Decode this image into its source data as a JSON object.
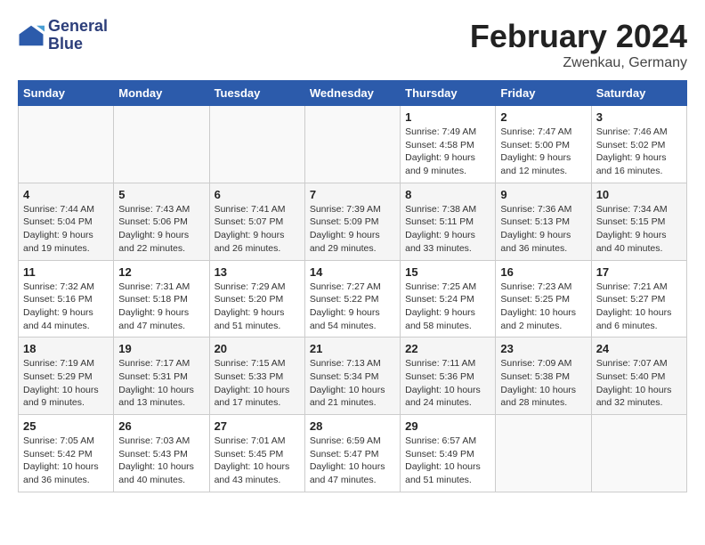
{
  "logo": {
    "line1": "General",
    "line2": "Blue"
  },
  "title": "February 2024",
  "subtitle": "Zwenkau, Germany",
  "days_of_week": [
    "Sunday",
    "Monday",
    "Tuesday",
    "Wednesday",
    "Thursday",
    "Friday",
    "Saturday"
  ],
  "weeks": [
    [
      {
        "day": "",
        "info": ""
      },
      {
        "day": "",
        "info": ""
      },
      {
        "day": "",
        "info": ""
      },
      {
        "day": "",
        "info": ""
      },
      {
        "day": "1",
        "info": "Sunrise: 7:49 AM\nSunset: 4:58 PM\nDaylight: 9 hours\nand 9 minutes."
      },
      {
        "day": "2",
        "info": "Sunrise: 7:47 AM\nSunset: 5:00 PM\nDaylight: 9 hours\nand 12 minutes."
      },
      {
        "day": "3",
        "info": "Sunrise: 7:46 AM\nSunset: 5:02 PM\nDaylight: 9 hours\nand 16 minutes."
      }
    ],
    [
      {
        "day": "4",
        "info": "Sunrise: 7:44 AM\nSunset: 5:04 PM\nDaylight: 9 hours\nand 19 minutes."
      },
      {
        "day": "5",
        "info": "Sunrise: 7:43 AM\nSunset: 5:06 PM\nDaylight: 9 hours\nand 22 minutes."
      },
      {
        "day": "6",
        "info": "Sunrise: 7:41 AM\nSunset: 5:07 PM\nDaylight: 9 hours\nand 26 minutes."
      },
      {
        "day": "7",
        "info": "Sunrise: 7:39 AM\nSunset: 5:09 PM\nDaylight: 9 hours\nand 29 minutes."
      },
      {
        "day": "8",
        "info": "Sunrise: 7:38 AM\nSunset: 5:11 PM\nDaylight: 9 hours\nand 33 minutes."
      },
      {
        "day": "9",
        "info": "Sunrise: 7:36 AM\nSunset: 5:13 PM\nDaylight: 9 hours\nand 36 minutes."
      },
      {
        "day": "10",
        "info": "Sunrise: 7:34 AM\nSunset: 5:15 PM\nDaylight: 9 hours\nand 40 minutes."
      }
    ],
    [
      {
        "day": "11",
        "info": "Sunrise: 7:32 AM\nSunset: 5:16 PM\nDaylight: 9 hours\nand 44 minutes."
      },
      {
        "day": "12",
        "info": "Sunrise: 7:31 AM\nSunset: 5:18 PM\nDaylight: 9 hours\nand 47 minutes."
      },
      {
        "day": "13",
        "info": "Sunrise: 7:29 AM\nSunset: 5:20 PM\nDaylight: 9 hours\nand 51 minutes."
      },
      {
        "day": "14",
        "info": "Sunrise: 7:27 AM\nSunset: 5:22 PM\nDaylight: 9 hours\nand 54 minutes."
      },
      {
        "day": "15",
        "info": "Sunrise: 7:25 AM\nSunset: 5:24 PM\nDaylight: 9 hours\nand 58 minutes."
      },
      {
        "day": "16",
        "info": "Sunrise: 7:23 AM\nSunset: 5:25 PM\nDaylight: 10 hours\nand 2 minutes."
      },
      {
        "day": "17",
        "info": "Sunrise: 7:21 AM\nSunset: 5:27 PM\nDaylight: 10 hours\nand 6 minutes."
      }
    ],
    [
      {
        "day": "18",
        "info": "Sunrise: 7:19 AM\nSunset: 5:29 PM\nDaylight: 10 hours\nand 9 minutes."
      },
      {
        "day": "19",
        "info": "Sunrise: 7:17 AM\nSunset: 5:31 PM\nDaylight: 10 hours\nand 13 minutes."
      },
      {
        "day": "20",
        "info": "Sunrise: 7:15 AM\nSunset: 5:33 PM\nDaylight: 10 hours\nand 17 minutes."
      },
      {
        "day": "21",
        "info": "Sunrise: 7:13 AM\nSunset: 5:34 PM\nDaylight: 10 hours\nand 21 minutes."
      },
      {
        "day": "22",
        "info": "Sunrise: 7:11 AM\nSunset: 5:36 PM\nDaylight: 10 hours\nand 24 minutes."
      },
      {
        "day": "23",
        "info": "Sunrise: 7:09 AM\nSunset: 5:38 PM\nDaylight: 10 hours\nand 28 minutes."
      },
      {
        "day": "24",
        "info": "Sunrise: 7:07 AM\nSunset: 5:40 PM\nDaylight: 10 hours\nand 32 minutes."
      }
    ],
    [
      {
        "day": "25",
        "info": "Sunrise: 7:05 AM\nSunset: 5:42 PM\nDaylight: 10 hours\nand 36 minutes."
      },
      {
        "day": "26",
        "info": "Sunrise: 7:03 AM\nSunset: 5:43 PM\nDaylight: 10 hours\nand 40 minutes."
      },
      {
        "day": "27",
        "info": "Sunrise: 7:01 AM\nSunset: 5:45 PM\nDaylight: 10 hours\nand 43 minutes."
      },
      {
        "day": "28",
        "info": "Sunrise: 6:59 AM\nSunset: 5:47 PM\nDaylight: 10 hours\nand 47 minutes."
      },
      {
        "day": "29",
        "info": "Sunrise: 6:57 AM\nSunset: 5:49 PM\nDaylight: 10 hours\nand 51 minutes."
      },
      {
        "day": "",
        "info": ""
      },
      {
        "day": "",
        "info": ""
      }
    ]
  ]
}
